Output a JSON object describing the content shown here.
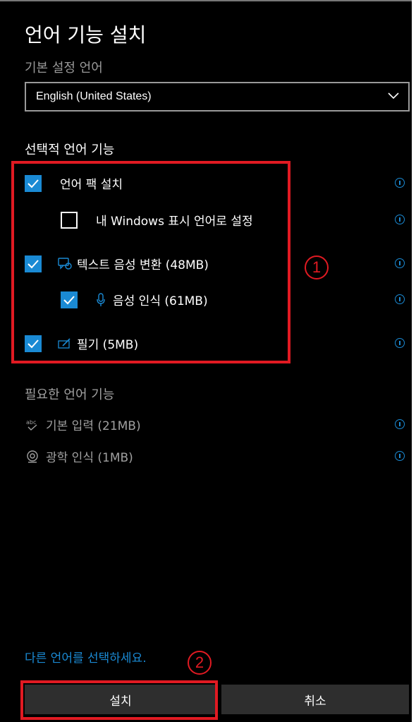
{
  "title": "언어 기능 설치",
  "preferred_language": {
    "label": "기본 설정 언어",
    "selected": "English (United States)"
  },
  "optional_features": {
    "title": "선택적 언어 기능",
    "items": [
      {
        "label": "언어 팩 설치",
        "checked": true
      },
      {
        "label": "내 Windows 표시 언어로 설정",
        "checked": false
      },
      {
        "label": "텍스트 음성 변환 (48MB)",
        "checked": true,
        "icon": "speech-bubble-icon"
      },
      {
        "label": "음성 인식 (61MB)",
        "checked": true,
        "icon": "microphone-icon"
      },
      {
        "label": "필기 (5MB)",
        "checked": true,
        "icon": "pen-icon"
      }
    ]
  },
  "required_features": {
    "title": "필요한 언어 기능",
    "items": [
      {
        "label": "기본 입력 (21MB)",
        "icon": "abc-spellcheck-icon"
      },
      {
        "label": "광학 인식 (1MB)",
        "icon": "ocr-eye-icon"
      }
    ]
  },
  "annotations": {
    "one": "1",
    "two": "2"
  },
  "choose_other_language_link": "다른 언어를 선택하세요.",
  "buttons": {
    "install": "설치",
    "cancel": "취소"
  },
  "colors": {
    "accent": "#1a8ad4",
    "highlight": "#e11a22",
    "background": "#000000"
  }
}
